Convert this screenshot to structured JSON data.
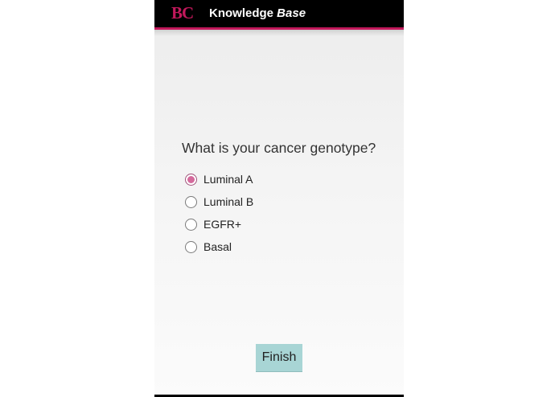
{
  "app_bar": {
    "logo_text": "BC",
    "title_plain": "Knowledge ",
    "title_italic": "Base",
    "accent_color": "#c2185b"
  },
  "form": {
    "question": "What is your cancer genotype?",
    "options": [
      {
        "label": "Luminal A",
        "selected": true
      },
      {
        "label": "Luminal B",
        "selected": false
      },
      {
        "label": "EGFR+",
        "selected": false
      },
      {
        "label": "Basal",
        "selected": false
      }
    ],
    "finish_label": "Finish",
    "finish_color": "#a8d5d5"
  }
}
